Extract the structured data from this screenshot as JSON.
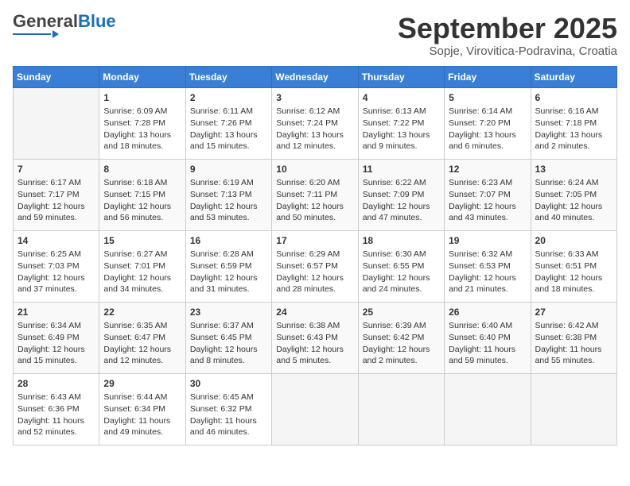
{
  "header": {
    "logo_general": "General",
    "logo_blue": "Blue",
    "month": "September 2025",
    "location": "Sopje, Virovitica-Podravina, Croatia"
  },
  "days_of_week": [
    "Sunday",
    "Monday",
    "Tuesday",
    "Wednesday",
    "Thursday",
    "Friday",
    "Saturday"
  ],
  "weeks": [
    [
      {
        "day": "",
        "info": ""
      },
      {
        "day": "1",
        "info": "Sunrise: 6:09 AM\nSunset: 7:28 PM\nDaylight: 13 hours\nand 18 minutes."
      },
      {
        "day": "2",
        "info": "Sunrise: 6:11 AM\nSunset: 7:26 PM\nDaylight: 13 hours\nand 15 minutes."
      },
      {
        "day": "3",
        "info": "Sunrise: 6:12 AM\nSunset: 7:24 PM\nDaylight: 13 hours\nand 12 minutes."
      },
      {
        "day": "4",
        "info": "Sunrise: 6:13 AM\nSunset: 7:22 PM\nDaylight: 13 hours\nand 9 minutes."
      },
      {
        "day": "5",
        "info": "Sunrise: 6:14 AM\nSunset: 7:20 PM\nDaylight: 13 hours\nand 6 minutes."
      },
      {
        "day": "6",
        "info": "Sunrise: 6:16 AM\nSunset: 7:18 PM\nDaylight: 13 hours\nand 2 minutes."
      }
    ],
    [
      {
        "day": "7",
        "info": "Sunrise: 6:17 AM\nSunset: 7:17 PM\nDaylight: 12 hours\nand 59 minutes."
      },
      {
        "day": "8",
        "info": "Sunrise: 6:18 AM\nSunset: 7:15 PM\nDaylight: 12 hours\nand 56 minutes."
      },
      {
        "day": "9",
        "info": "Sunrise: 6:19 AM\nSunset: 7:13 PM\nDaylight: 12 hours\nand 53 minutes."
      },
      {
        "day": "10",
        "info": "Sunrise: 6:20 AM\nSunset: 7:11 PM\nDaylight: 12 hours\nand 50 minutes."
      },
      {
        "day": "11",
        "info": "Sunrise: 6:22 AM\nSunset: 7:09 PM\nDaylight: 12 hours\nand 47 minutes."
      },
      {
        "day": "12",
        "info": "Sunrise: 6:23 AM\nSunset: 7:07 PM\nDaylight: 12 hours\nand 43 minutes."
      },
      {
        "day": "13",
        "info": "Sunrise: 6:24 AM\nSunset: 7:05 PM\nDaylight: 12 hours\nand 40 minutes."
      }
    ],
    [
      {
        "day": "14",
        "info": "Sunrise: 6:25 AM\nSunset: 7:03 PM\nDaylight: 12 hours\nand 37 minutes."
      },
      {
        "day": "15",
        "info": "Sunrise: 6:27 AM\nSunset: 7:01 PM\nDaylight: 12 hours\nand 34 minutes."
      },
      {
        "day": "16",
        "info": "Sunrise: 6:28 AM\nSunset: 6:59 PM\nDaylight: 12 hours\nand 31 minutes."
      },
      {
        "day": "17",
        "info": "Sunrise: 6:29 AM\nSunset: 6:57 PM\nDaylight: 12 hours\nand 28 minutes."
      },
      {
        "day": "18",
        "info": "Sunrise: 6:30 AM\nSunset: 6:55 PM\nDaylight: 12 hours\nand 24 minutes."
      },
      {
        "day": "19",
        "info": "Sunrise: 6:32 AM\nSunset: 6:53 PM\nDaylight: 12 hours\nand 21 minutes."
      },
      {
        "day": "20",
        "info": "Sunrise: 6:33 AM\nSunset: 6:51 PM\nDaylight: 12 hours\nand 18 minutes."
      }
    ],
    [
      {
        "day": "21",
        "info": "Sunrise: 6:34 AM\nSunset: 6:49 PM\nDaylight: 12 hours\nand 15 minutes."
      },
      {
        "day": "22",
        "info": "Sunrise: 6:35 AM\nSunset: 6:47 PM\nDaylight: 12 hours\nand 12 minutes."
      },
      {
        "day": "23",
        "info": "Sunrise: 6:37 AM\nSunset: 6:45 PM\nDaylight: 12 hours\nand 8 minutes."
      },
      {
        "day": "24",
        "info": "Sunrise: 6:38 AM\nSunset: 6:43 PM\nDaylight: 12 hours\nand 5 minutes."
      },
      {
        "day": "25",
        "info": "Sunrise: 6:39 AM\nSunset: 6:42 PM\nDaylight: 12 hours\nand 2 minutes."
      },
      {
        "day": "26",
        "info": "Sunrise: 6:40 AM\nSunset: 6:40 PM\nDaylight: 11 hours\nand 59 minutes."
      },
      {
        "day": "27",
        "info": "Sunrise: 6:42 AM\nSunset: 6:38 PM\nDaylight: 11 hours\nand 55 minutes."
      }
    ],
    [
      {
        "day": "28",
        "info": "Sunrise: 6:43 AM\nSunset: 6:36 PM\nDaylight: 11 hours\nand 52 minutes."
      },
      {
        "day": "29",
        "info": "Sunrise: 6:44 AM\nSunset: 6:34 PM\nDaylight: 11 hours\nand 49 minutes."
      },
      {
        "day": "30",
        "info": "Sunrise: 6:45 AM\nSunset: 6:32 PM\nDaylight: 11 hours\nand 46 minutes."
      },
      {
        "day": "",
        "info": ""
      },
      {
        "day": "",
        "info": ""
      },
      {
        "day": "",
        "info": ""
      },
      {
        "day": "",
        "info": ""
      }
    ]
  ]
}
